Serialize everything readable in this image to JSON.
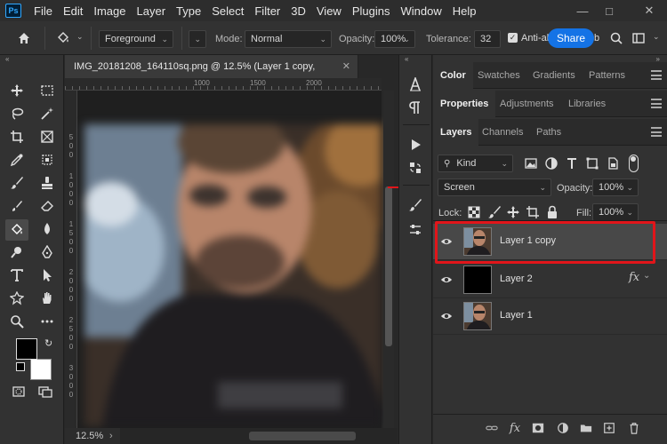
{
  "app": {
    "logo": "Ps"
  },
  "menu": [
    "File",
    "Edit",
    "Image",
    "Layer",
    "Type",
    "Select",
    "Filter",
    "3D",
    "View",
    "Plugins",
    "Window",
    "Help"
  ],
  "options": {
    "fill_source": "Foreground",
    "mode_label": "Mode:",
    "mode_value": "Normal",
    "opacity_label": "Opacity:",
    "opacity_value": "100%",
    "tolerance_label": "Tolerance:",
    "tolerance_value": "32",
    "antialias_label": "Anti-al",
    "share_label": "Share"
  },
  "document": {
    "tab_title": "IMG_20181208_164110sq.png @ 12.5% (Layer 1 copy,",
    "zoom": "12.5%",
    "ruler_h_labels": [
      "1000",
      "1500",
      "2000"
    ],
    "ruler_v_labels": [
      "5",
      "0",
      "0",
      "1",
      "0",
      "0",
      "0",
      "1",
      "5",
      "0",
      "0",
      "2",
      "0",
      "0",
      "0",
      "2",
      "5",
      "0",
      "0",
      "3",
      "0",
      "0",
      "0"
    ]
  },
  "panels": {
    "top_tabs": [
      "Color",
      "Swatches",
      "Gradients",
      "Patterns"
    ],
    "mid_tabs": [
      "Properties",
      "Adjustments",
      "Libraries"
    ],
    "layer_tabs": [
      "Layers",
      "Channels",
      "Paths"
    ],
    "filter_kind": "Kind",
    "blend_mode": "Screen",
    "opacity_label": "Opacity:",
    "opacity_value": "100%",
    "lock_label": "Lock:",
    "fill_label": "Fill:",
    "fill_value": "100%",
    "layers": [
      {
        "name": "Layer 1 copy",
        "selected": true
      },
      {
        "name": "Layer 2",
        "fx": "fx"
      },
      {
        "name": "Layer 1"
      }
    ]
  },
  "colors": {
    "accent": "#1473e6",
    "highlight": "#e1151a",
    "selected_layer": "#484848"
  }
}
